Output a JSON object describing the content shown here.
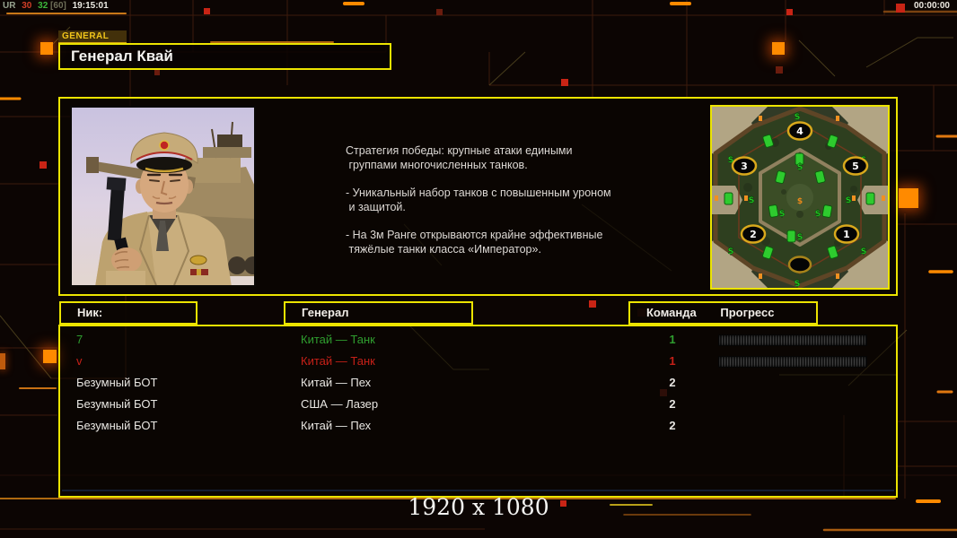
{
  "overlay": {
    "stats_tokens": [
      "UR",
      "30",
      "32",
      "[60]",
      "19:15:01"
    ],
    "stats_colors": [
      "#97a38f",
      "#d23f28",
      "#3cb83c",
      "#6e6e58",
      "#ecebe4"
    ],
    "timer": "00:00:00",
    "resolution_label": "1920 x 1080"
  },
  "panel": {
    "tab_label": "GENERAL",
    "title": "Генерал Квай"
  },
  "about": {
    "paragraphs": [
      "Стратегия победы: крупные атаки едиными\n группами многочисленных танков.",
      "- Уникальный набор танков с повышенным уроном\n и защитой.",
      "- На 3м Ранге открываются крайне эффективные\n тяжёлые танки класса «Император»."
    ]
  },
  "map": {
    "supply_symbol": "$",
    "positions": [
      "4",
      "3",
      "5",
      "2",
      "1"
    ]
  },
  "roster": {
    "headers": {
      "nick": "Ник:",
      "general": "Генерал",
      "team": "Команда",
      "progress": "Прогресс"
    },
    "players": [
      {
        "nick": "7",
        "general": "Китай — Танк",
        "team": "1",
        "color": "#2f9e2f"
      },
      {
        "nick": "v",
        "general": "Китай — Танк",
        "team": "1",
        "color": "#c62018"
      },
      {
        "nick": "Безумный БОТ",
        "general": "Китай — Пех",
        "team": "2",
        "color": "#e8e6e2"
      },
      {
        "nick": "Безумный БОТ",
        "general": "США — Лазер",
        "team": "2",
        "color": "#e8e6e2"
      },
      {
        "nick": "Безумный БОТ",
        "general": "Китай — Пех",
        "team": "2",
        "color": "#e8e6e2"
      }
    ]
  },
  "colors": {
    "accent_yellow": "#ece400",
    "accent_orange": "#ff8a00",
    "team1_green": "#2f9e2f",
    "team1_red": "#c62018"
  }
}
